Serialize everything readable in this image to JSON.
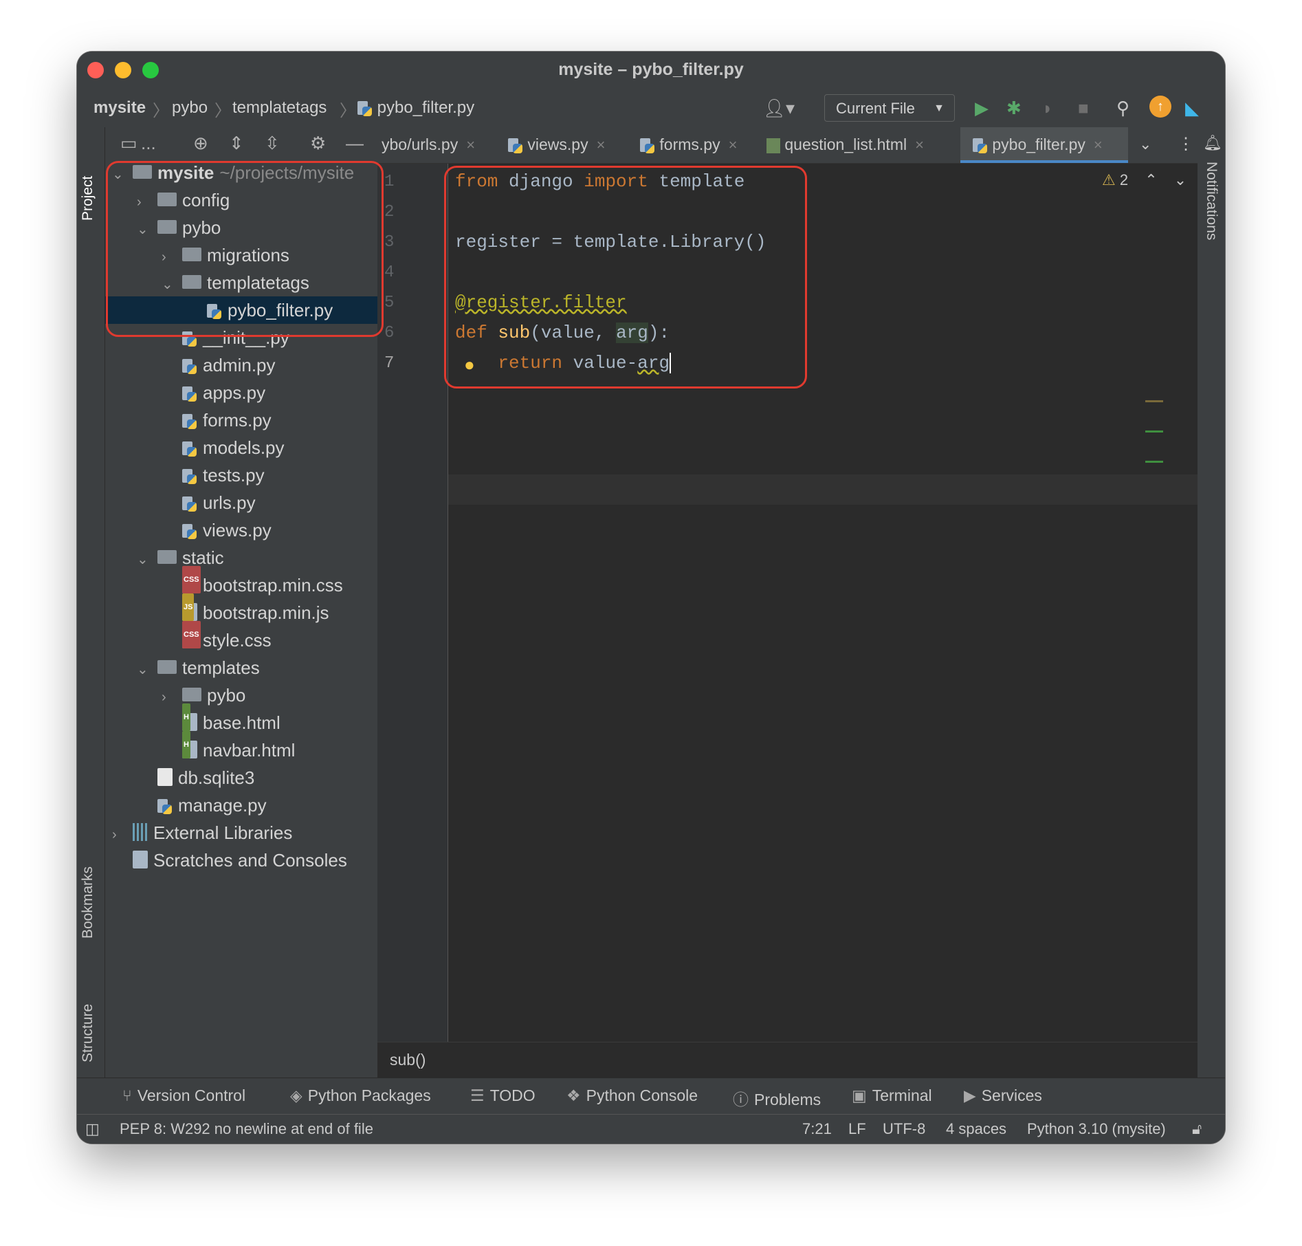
{
  "window": {
    "title": "mysite – pybo_filter.py"
  },
  "navbar": {
    "crumbs": [
      "mysite",
      "pybo",
      "templatetags",
      "pybo_filter.py"
    ],
    "run_config": "Current File"
  },
  "side_labels": {
    "project": "Project",
    "bookmarks": "Bookmarks",
    "structure": "Structure",
    "notifications": "Notifications"
  },
  "project_toolbar": {
    "dots": "..."
  },
  "tree": [
    {
      "label": "mysite",
      "extra": "~/projects/mysite",
      "type": "folder",
      "depth": 0,
      "arrow": "open"
    },
    {
      "label": "config",
      "type": "folder",
      "depth": 1,
      "arrow": "closed"
    },
    {
      "label": "pybo",
      "type": "folder",
      "depth": 1,
      "arrow": "open"
    },
    {
      "label": "migrations",
      "type": "folder",
      "depth": 2,
      "arrow": "closed"
    },
    {
      "label": "templatetags",
      "type": "folder",
      "depth": 2,
      "arrow": "open"
    },
    {
      "label": "pybo_filter.py",
      "type": "py",
      "depth": 3,
      "selected": true
    },
    {
      "label": "__init__.py",
      "type": "py",
      "depth": 2
    },
    {
      "label": "admin.py",
      "type": "py",
      "depth": 2
    },
    {
      "label": "apps.py",
      "type": "py",
      "depth": 2
    },
    {
      "label": "forms.py",
      "type": "py",
      "depth": 2
    },
    {
      "label": "models.py",
      "type": "py",
      "depth": 2
    },
    {
      "label": "tests.py",
      "type": "py",
      "depth": 2
    },
    {
      "label": "urls.py",
      "type": "py",
      "depth": 2
    },
    {
      "label": "views.py",
      "type": "py",
      "depth": 2
    },
    {
      "label": "static",
      "type": "folder",
      "depth": 1,
      "arrow": "open"
    },
    {
      "label": "bootstrap.min.css",
      "type": "css",
      "depth": 2
    },
    {
      "label": "bootstrap.min.js",
      "type": "js",
      "depth": 2
    },
    {
      "label": "style.css",
      "type": "css",
      "depth": 2
    },
    {
      "label": "templates",
      "type": "folder",
      "depth": 1,
      "arrow": "open"
    },
    {
      "label": "pybo",
      "type": "folder",
      "depth": 2,
      "arrow": "closed"
    },
    {
      "label": "base.html",
      "type": "html",
      "depth": 2
    },
    {
      "label": "navbar.html",
      "type": "html",
      "depth": 2
    },
    {
      "label": "db.sqlite3",
      "type": "file",
      "depth": 1
    },
    {
      "label": "manage.py",
      "type": "py",
      "depth": 1
    },
    {
      "label": "External Libraries",
      "type": "lib",
      "depth": 0,
      "arrow": "closed"
    },
    {
      "label": "Scratches and Consoles",
      "type": "scratch",
      "depth": 0
    }
  ],
  "file_badges": {
    "css": "CSS",
    "js": "JS",
    "html": "H"
  },
  "tabs": [
    {
      "label": "ybo/urls.py",
      "active": false
    },
    {
      "label": "views.py",
      "active": false
    },
    {
      "label": "forms.py",
      "active": false
    },
    {
      "label": "question_list.html",
      "active": false
    },
    {
      "label": "pybo_filter.py",
      "active": true
    }
  ],
  "tab_close": "×",
  "line_numbers": [
    "1",
    "2",
    "3",
    "4",
    "5",
    "6",
    "7"
  ],
  "code": {
    "l1": {
      "kw1": "from",
      "t1": " django ",
      "kw2": "import",
      "t2": " template"
    },
    "l3": "register = template.Library()",
    "l5": "@register.filter",
    "l6": {
      "kw": "def",
      "fn": "sub",
      "t1": "(value, ",
      "param": "arg",
      "t2": "):"
    },
    "l7": {
      "kw": "return",
      "t1": " value-",
      "param": "arg"
    }
  },
  "inspection": {
    "warning_count": "2"
  },
  "code_breadcrumb": "sub()",
  "tool_windows": [
    "Version Control",
    "Python Packages",
    "TODO",
    "Python Console",
    "Problems",
    "Terminal",
    "Services"
  ],
  "status": {
    "message": "PEP 8: W292 no newline at end of file",
    "position": "7:21",
    "line_sep": "LF",
    "encoding": "UTF-8",
    "indent": "4 spaces",
    "interpreter": "Python 3.10 (mysite)"
  },
  "colors": {
    "highlight_box": "#e03a2f",
    "selection": "#0d293e",
    "keyword": "#cc7832",
    "decorator": "#bbb529",
    "function": "#ffc66d"
  }
}
